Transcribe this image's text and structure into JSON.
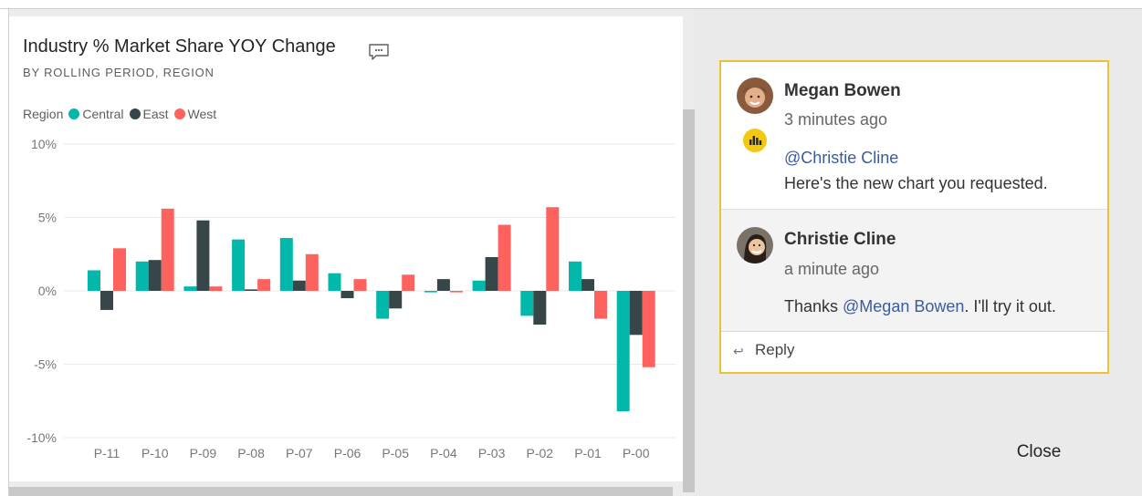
{
  "visual": {
    "title": "Industry % Market Share YOY Change",
    "subtitle": "BY ROLLING PERIOD, REGION",
    "legend_title": "Region",
    "comment_icon": "comment-icon"
  },
  "chart_data": {
    "type": "bar",
    "categories": [
      "P-11",
      "P-10",
      "P-09",
      "P-08",
      "P-07",
      "P-06",
      "P-05",
      "P-04",
      "P-03",
      "P-02",
      "P-01",
      "P-00"
    ],
    "series": [
      {
        "name": "Central",
        "color": "#01b8aa",
        "values": [
          1.4,
          2.0,
          0.3,
          3.5,
          3.6,
          1.2,
          -1.9,
          -0.1,
          0.7,
          -1.7,
          2.0,
          -8.2
        ]
      },
      {
        "name": "East",
        "color": "#374649",
        "values": [
          -1.3,
          2.1,
          4.8,
          0.1,
          0.7,
          -0.5,
          -1.2,
          0.8,
          2.3,
          -2.3,
          0.8,
          -3.0
        ]
      },
      {
        "name": "West",
        "color": "#fd625e",
        "values": [
          2.9,
          5.6,
          0.3,
          0.8,
          2.5,
          0.8,
          1.1,
          -0.1,
          4.5,
          5.7,
          -1.9,
          -5.2
        ]
      }
    ],
    "ylim": [
      -10,
      10
    ],
    "yticks": [
      -10,
      -5,
      0,
      5,
      10
    ],
    "ytick_labels": [
      "-10%",
      "-5%",
      "0%",
      "5%",
      "10%"
    ],
    "grid": true,
    "legend_position": "top-left"
  },
  "comments": {
    "first": {
      "author": "Megan Bowen",
      "time": "3 minutes ago",
      "mention": "@Christie Cline",
      "text": "Here's the new chart you requested."
    },
    "reply": {
      "author": "Christie Cline",
      "time": "a minute ago",
      "text_before": "Thanks ",
      "mention": "@Megan Bowen",
      "text_after": ". I'll try it out."
    },
    "reply_label": "Reply",
    "reply_icon": "reply-arrow-icon",
    "badge_icon": "power-bi-icon"
  },
  "close_label": "Close",
  "colors": {
    "comment_border": "#e8c33a",
    "mention": "#3a5ba0",
    "badge": "#f2c811"
  }
}
